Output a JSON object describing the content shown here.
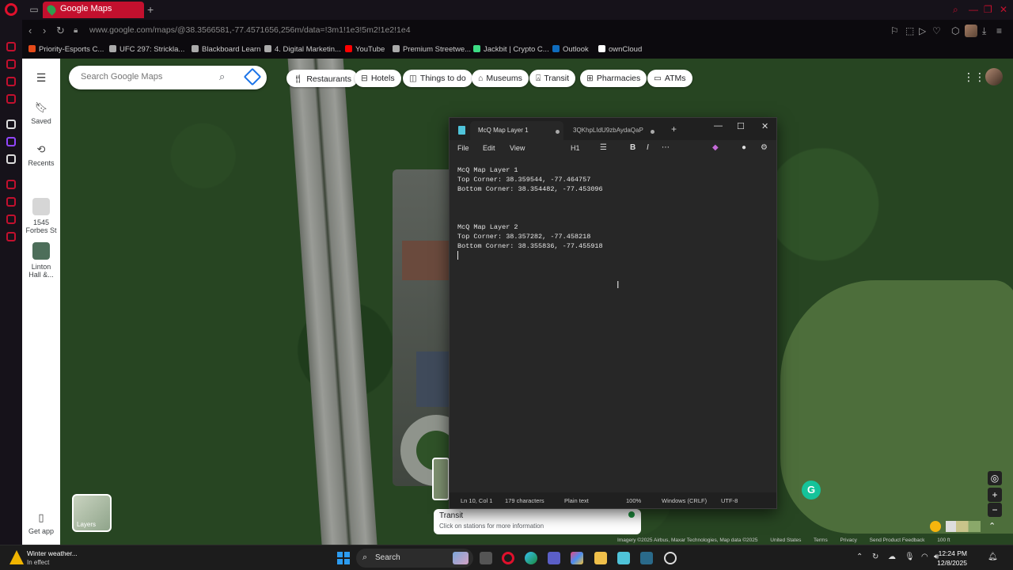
{
  "browser": {
    "tab_title": "Google Maps",
    "url": "www.google.com/maps/@38.3566581,-77.4571656,256m/data=!3m1!1e3!5m2!1e2!1e4",
    "bookmarks": [
      {
        "label": "Priority-Esports C...",
        "color": "#e64a19"
      },
      {
        "label": "UFC 297: Strickla...",
        "color": "#aaaaaa"
      },
      {
        "label": "Blackboard Learn",
        "color": "#aaaaaa"
      },
      {
        "label": "4. Digital Marketin...",
        "color": "#aaaaaa"
      },
      {
        "label": "YouTube",
        "color": "#ff0000"
      },
      {
        "label": "Premium Streetwe...",
        "color": "#aaaaaa"
      },
      {
        "label": "Jackbit | Crypto C...",
        "color": "#3ddc84"
      },
      {
        "label": "Outlook",
        "color": "#0f6cbd"
      },
      {
        "label": "ownCloud",
        "color": "#ffffff"
      }
    ]
  },
  "maps": {
    "search_placeholder": "Search Google Maps",
    "rail": {
      "saved": "Saved",
      "recents": "Recents",
      "recent1": "1545 Forbes St",
      "recent2": "Linton Hall &...",
      "get_app": "Get app"
    },
    "chips": [
      "Restaurants",
      "Hotels",
      "Things to do",
      "Museums",
      "Transit",
      "Pharmacies",
      "ATMs"
    ],
    "layers_label": "Layers",
    "transit_card": {
      "title": "Transit",
      "subtitle": "Click on stations for more information"
    },
    "footer": {
      "imagery": "Imagery ©2025 Airbus, Maxar Technologies, Map data ©2025",
      "country": "United States",
      "terms": "Terms",
      "privacy": "Privacy",
      "feedback": "Send Product Feedback",
      "scale": "100 ft"
    }
  },
  "notepad": {
    "tab1": "McQ Map Layer 1",
    "tab2": "3QKhpLIdU9zbAydaQaP",
    "menu": {
      "file": "File",
      "edit": "Edit",
      "view": "View",
      "heading": "H1"
    },
    "lines": [
      "McQ Map Layer 1",
      "Top Corner: 38.359544, -77.464757",
      "Bottom Corner: 38.354482, -77.453096",
      "",
      "",
      "",
      "McQ Map Layer 2",
      "Top Corner: 38.357282, -77.458218",
      "Bottom Corner: 38.355836, -77.455918",
      ""
    ],
    "status": {
      "position": "Ln 10, Col 1",
      "chars": "179 characters",
      "format": "Plain text",
      "zoom": "100%",
      "eol": "Windows (CRLF)",
      "encoding": "UTF-8"
    }
  },
  "taskbar": {
    "weather_title": "Winter weather...",
    "weather_sub": "In effect",
    "search_label": "Search",
    "time": "12:24 PM",
    "date": "12/8/2025"
  }
}
